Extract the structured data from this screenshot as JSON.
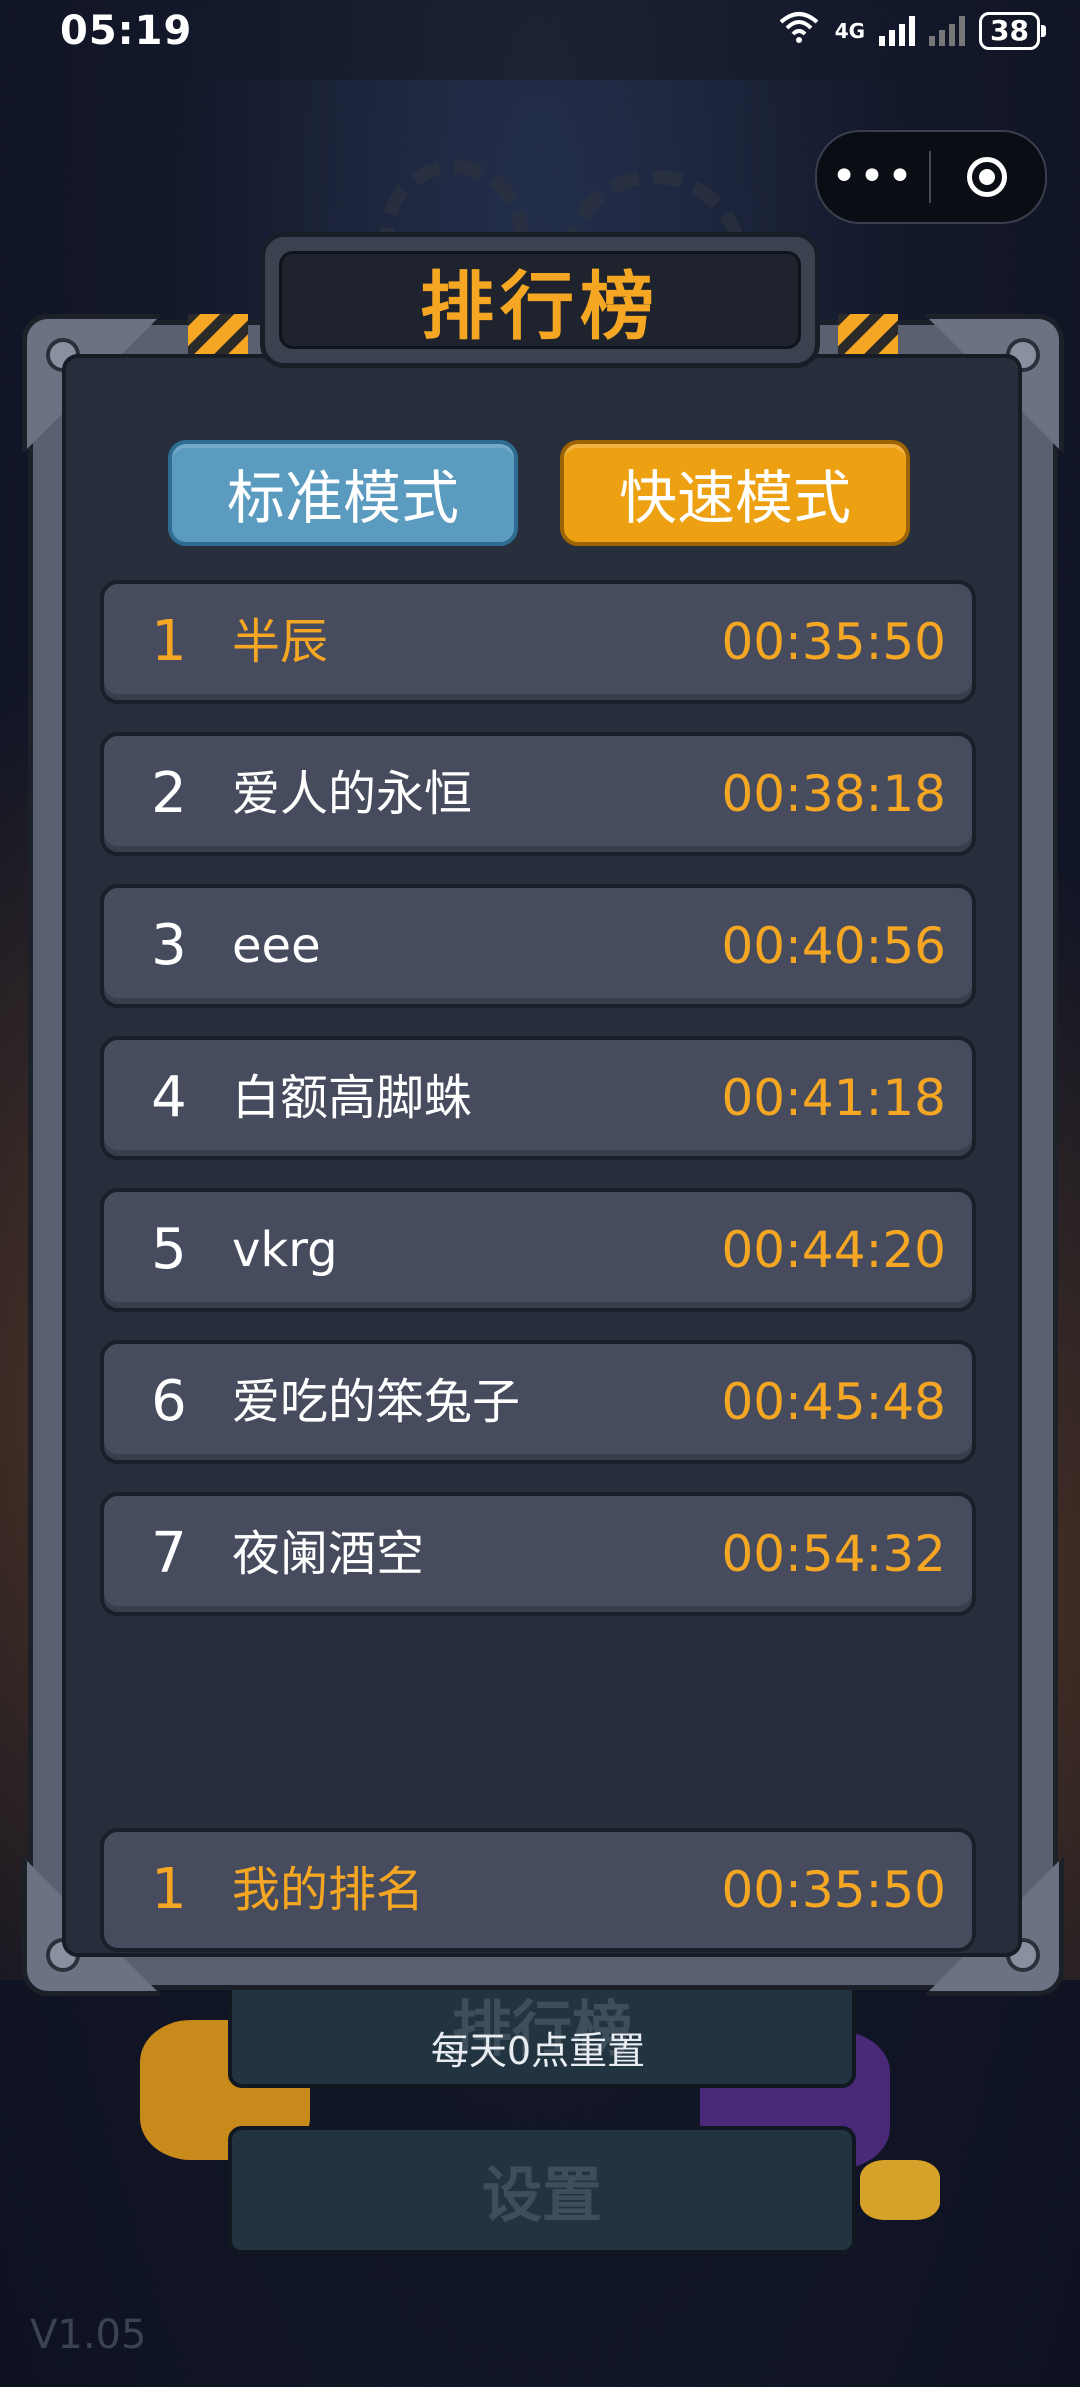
{
  "status_bar": {
    "time": "05:19",
    "wifi_label": "6",
    "network": "4G",
    "battery": "38"
  },
  "capsule": {
    "more_icon": "more-dots-icon",
    "close_icon": "target-icon"
  },
  "panel": {
    "title": "排行榜",
    "tabs": [
      {
        "label": "标准模式",
        "active": false,
        "color": "#5b9bc0"
      },
      {
        "label": "快速模式",
        "active": true,
        "color": "#eda012"
      }
    ],
    "entries": [
      {
        "rank": "1",
        "name": "半辰",
        "time": "00:35:50"
      },
      {
        "rank": "2",
        "name": "爱人的永恒",
        "time": "00:38:18"
      },
      {
        "rank": "3",
        "name": "eee",
        "time": "00:40:56"
      },
      {
        "rank": "4",
        "name": "白额高脚蛛",
        "time": "00:41:18"
      },
      {
        "rank": "5",
        "name": "vkrg",
        "time": "00:44:20"
      },
      {
        "rank": "6",
        "name": "爱吃的笨兔子",
        "time": "00:45:48"
      },
      {
        "rank": "7",
        "name": "夜阑酒空",
        "time": "00:54:32"
      }
    ],
    "my_rank": {
      "rank": "1",
      "name": "我的排名",
      "time": "00:35:50"
    }
  },
  "background": {
    "menu_leaderboard": "排行榜",
    "reset_note": "每天0点重置",
    "menu_settings": "设置",
    "version": "V1.05"
  },
  "colors": {
    "accent": "#f5a623",
    "panel_bg": "#272e3c",
    "row_bg": "#464c5e"
  }
}
